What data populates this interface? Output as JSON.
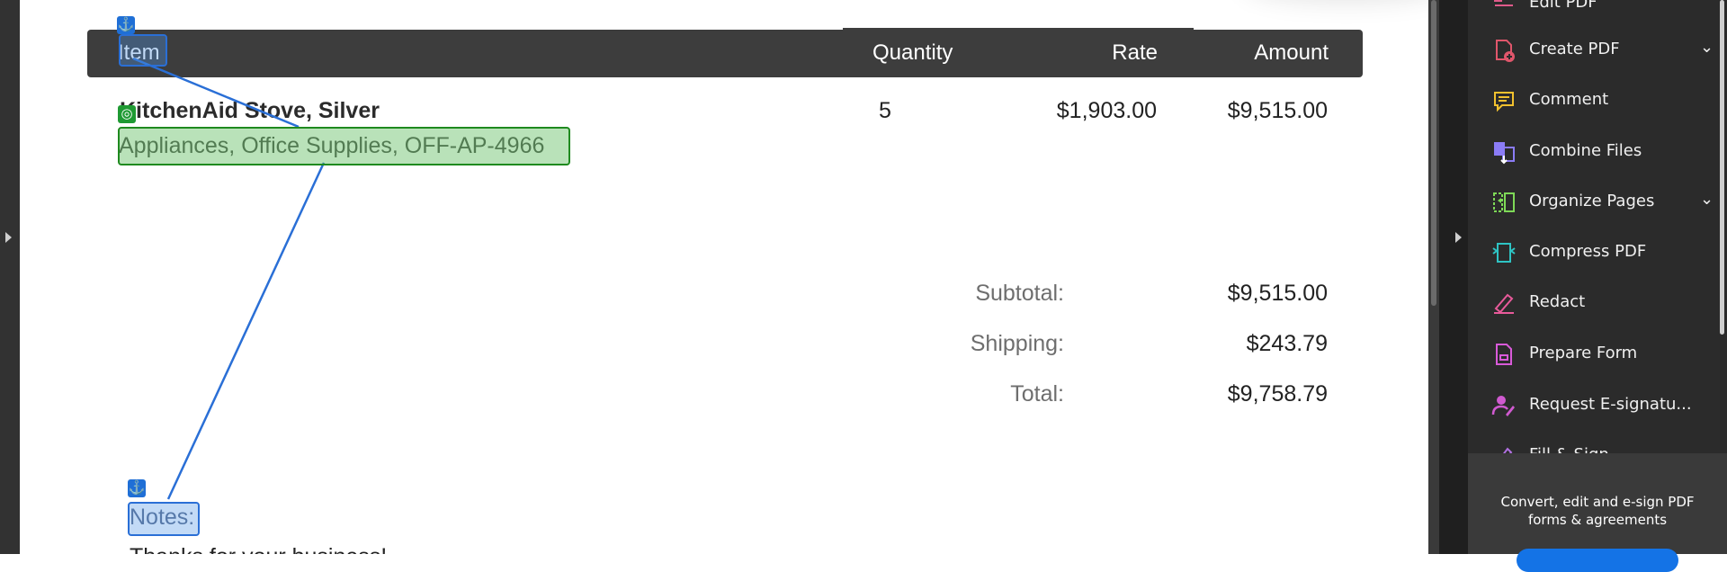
{
  "table": {
    "headers": {
      "item": "Item",
      "quantity": "Quantity",
      "rate": "Rate",
      "amount": "Amount"
    },
    "rows": [
      {
        "name": "KitchenAid Stove, Silver",
        "description": "Appliances, Office Supplies, OFF-AP-4966",
        "quantity": "5",
        "rate": "$1,903.00",
        "amount": "$9,515.00"
      }
    ]
  },
  "summary": {
    "subtotal_label": "Subtotal:",
    "subtotal_value": "$9,515.00",
    "shipping_label": "Shipping:",
    "shipping_value": "$243.79",
    "total_label": "Total:",
    "total_value": "$9,758.79"
  },
  "notes": {
    "label": "Notes:",
    "text": "Thanks for your business!"
  },
  "annotations": {
    "anchor_glyph": "⚓",
    "target_glyph": "◎"
  },
  "tools": {
    "items": [
      {
        "label": "Edit PDF",
        "icon": "edit-pdf-icon",
        "color": "#e05a8a"
      },
      {
        "label": "Create PDF",
        "icon": "create-pdf-icon",
        "color": "#e0566b",
        "has_chevron": true
      },
      {
        "label": "Comment",
        "icon": "comment-icon",
        "color": "#f2c12e"
      },
      {
        "label": "Combine Files",
        "icon": "combine-files-icon",
        "color": "#8b7cf6"
      },
      {
        "label": "Organize Pages",
        "icon": "organize-pages-icon",
        "color": "#7ed957",
        "has_chevron": true
      },
      {
        "label": "Compress PDF",
        "icon": "compress-pdf-icon",
        "color": "#2ec4c4"
      },
      {
        "label": "Redact",
        "icon": "redact-icon",
        "color": "#e85a9a"
      },
      {
        "label": "Prepare Form",
        "icon": "prepare-form-icon",
        "color": "#d95ad9"
      },
      {
        "label": "Request E-signatu...",
        "icon": "request-esignature-icon",
        "color": "#d05ad0"
      },
      {
        "label": "Fill & Sign",
        "icon": "fill-sign-icon",
        "color": "#b070e0"
      }
    ],
    "chevron_glyph": "⌄",
    "promo_text": "Convert, edit and e-sign PDF forms & agreements"
  },
  "colors": {
    "header_bg": "#3d3d3d",
    "highlight_blue": "#2a6fd6",
    "highlight_green": "#1f8a1f",
    "panel_bg": "#2b2b2b"
  }
}
